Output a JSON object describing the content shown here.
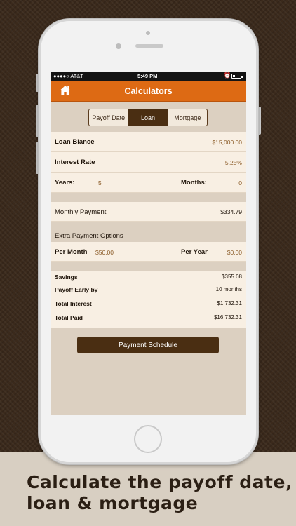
{
  "status_bar": {
    "carrier": "●●●●○ AT&T",
    "time": "5:49 PM",
    "alarm_icon": "alarm-icon"
  },
  "nav": {
    "title": "Calculators",
    "home_icon": "home-icon",
    "accent_color": "#dd6a14"
  },
  "segments": [
    {
      "label": "Payoff Date",
      "selected": false
    },
    {
      "label": "Loan",
      "selected": true
    },
    {
      "label": "Mortgage",
      "selected": false
    }
  ],
  "loan_inputs": {
    "loan_balance_label": "Loan Blance",
    "loan_balance_value": "$15,000.00",
    "interest_rate_label": "Interest Rate",
    "interest_rate_value": "5.25%",
    "years_label": "Years:",
    "years_value": "5",
    "months_label": "Months:",
    "months_value": "0"
  },
  "monthly_payment": {
    "label": "Monthly Payment",
    "value": "$334.79"
  },
  "extra_payment": {
    "header": "Extra Payment Options",
    "per_month_label": "Per Month",
    "per_month_value": "$50.00",
    "per_year_label": "Per Year",
    "per_year_value": "$0.00"
  },
  "summary": {
    "savings_label": "Savings",
    "savings_value": "$355.08",
    "payoff_label": "Payoff Early by",
    "payoff_value": "10 months",
    "total_interest_label": "Total Interest",
    "total_interest_value": "$1,732.31",
    "total_paid_label": "Total Paid",
    "total_paid_value": "$16,732.31"
  },
  "schedule_button": "Payment Schedule",
  "caption": {
    "line1": "Calculate the payoff date,",
    "line2": "loan & mortgage"
  }
}
